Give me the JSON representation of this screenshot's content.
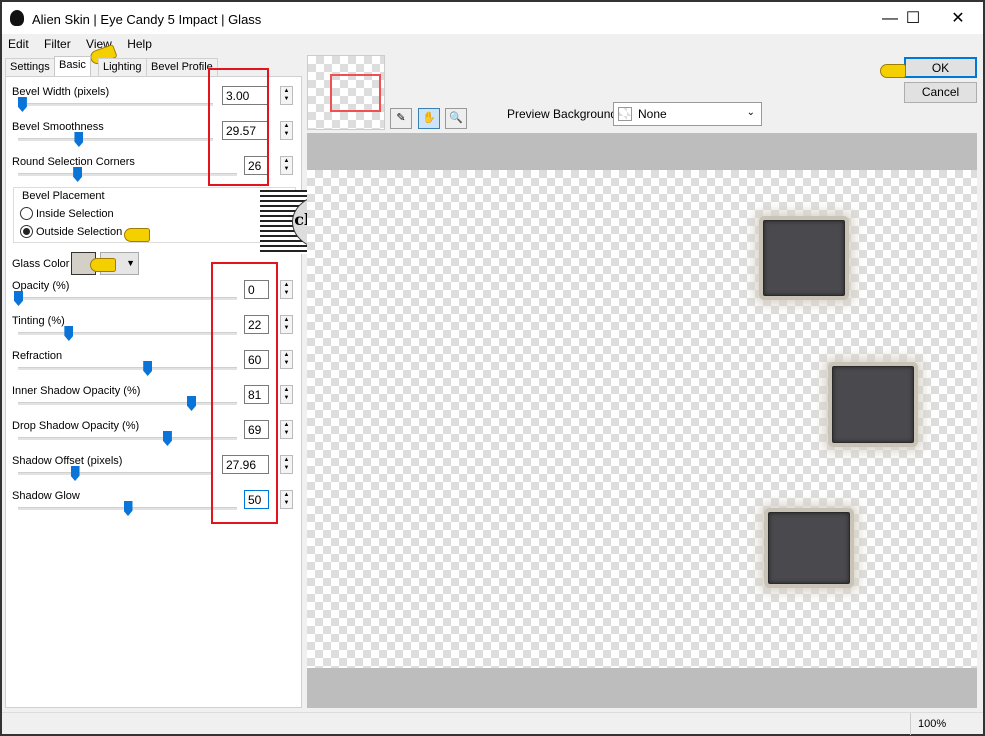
{
  "window": {
    "title": "Alien Skin | Eye Candy 5 Impact | Glass",
    "minimize": "—",
    "maximize": "☐",
    "close": "✕"
  },
  "menu": [
    "Edit",
    "Filter",
    "View",
    "Help"
  ],
  "tabs": [
    "Settings",
    "Basic",
    "Lighting",
    "Bevel Profile"
  ],
  "active_tab": "Basic",
  "basic": {
    "top_controls": [
      {
        "label": "Bevel Width (pixels)",
        "value": "3.00",
        "slider_level": 0.02
      },
      {
        "label": "Bevel Smoothness",
        "value": "29.57",
        "slider_level": 0.31
      },
      {
        "label": "Round Selection Corners",
        "value": "26",
        "slider_level": 0.27
      }
    ],
    "bevel_placement": {
      "label": "Bevel Placement",
      "options": [
        "Inside Selection",
        "Outside Selection"
      ],
      "selected": "Outside Selection"
    },
    "glass_color": {
      "label": "Glass Color",
      "color": "#d4d0c8"
    },
    "bottom_controls": [
      {
        "label": "Opacity (%)",
        "value": "0",
        "slider_level": 0.0
      },
      {
        "label": "Tinting (%)",
        "value": "22",
        "slider_level": 0.23
      },
      {
        "label": "Refraction",
        "value": "60",
        "slider_level": 0.59
      },
      {
        "label": "Inner Shadow Opacity (%)",
        "value": "81",
        "slider_level": 0.79
      },
      {
        "label": "Drop Shadow Opacity (%)",
        "value": "69",
        "slider_level": 0.68
      },
      {
        "label": "Shadow Offset (pixels)",
        "value": "27.96",
        "slider_level": 0.29
      },
      {
        "label": "Shadow Glow",
        "value": "50",
        "slider_level": 0.5
      }
    ]
  },
  "watermark": "claudia",
  "preview": {
    "background_label": "Preview Background:",
    "background_value": "None"
  },
  "buttons": {
    "ok": "OK",
    "cancel": "Cancel"
  },
  "status": {
    "zoom": "100%"
  },
  "colors": {
    "accent": "#0a74d8",
    "highlight": "#e3141b"
  }
}
